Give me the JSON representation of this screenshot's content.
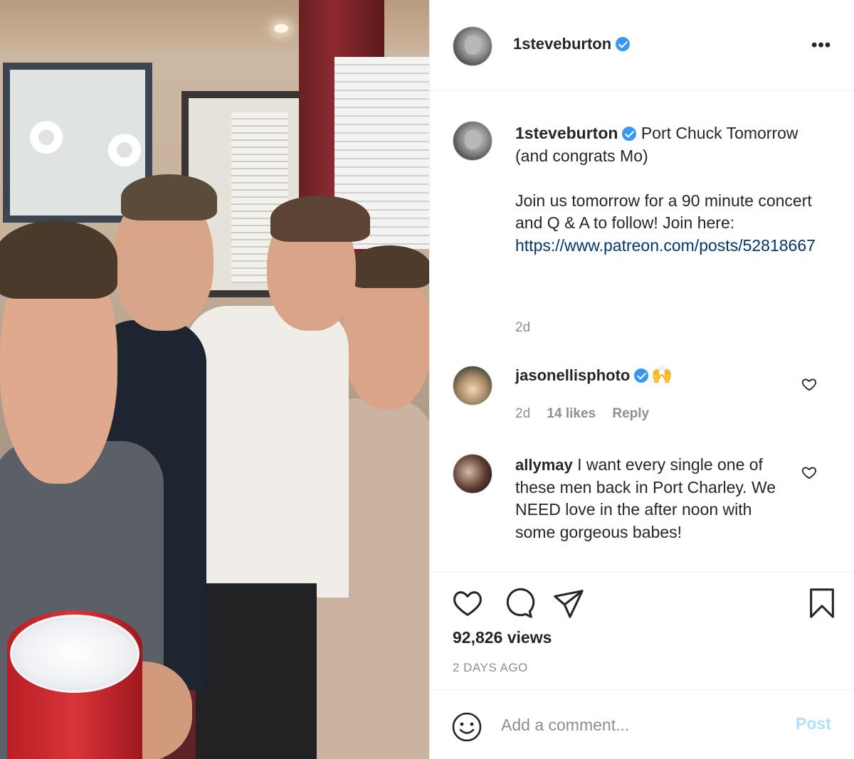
{
  "post": {
    "username": "1steveburton",
    "verified": true,
    "more_icon": "more-horizontal-icon"
  },
  "caption": {
    "username": "1steveburton",
    "line1": "Port Chuck Tomorrow (and congrats Mo)",
    "body": "Join us tomorrow for a 90 minute concert and Q & A to follow! Join here:",
    "link": "https://www.patreon.com/posts/52818667",
    "time": "2d"
  },
  "comments": [
    {
      "username": "jasonellisphoto",
      "verified": true,
      "text": "🙌",
      "time": "2d",
      "likes": "14 likes",
      "reply": "Reply"
    },
    {
      "username": "allymay",
      "verified": false,
      "text": "I want every single one of these men back in Port Charley. We NEED love in the after noon with some gorgeous babes!"
    }
  ],
  "actions": {
    "icons": [
      "heart-icon",
      "comment-icon",
      "share-icon",
      "bookmark-icon"
    ],
    "views": "92,826 views",
    "ago": "2 DAYS AGO"
  },
  "add_comment": {
    "placeholder": "Add a comment...",
    "post_label": "Post",
    "post_color": "#b2dffc"
  },
  "colors": {
    "text": "#262626",
    "secondary": "#8e8e8e",
    "link": "#00376b",
    "verified": "#3897f0"
  }
}
